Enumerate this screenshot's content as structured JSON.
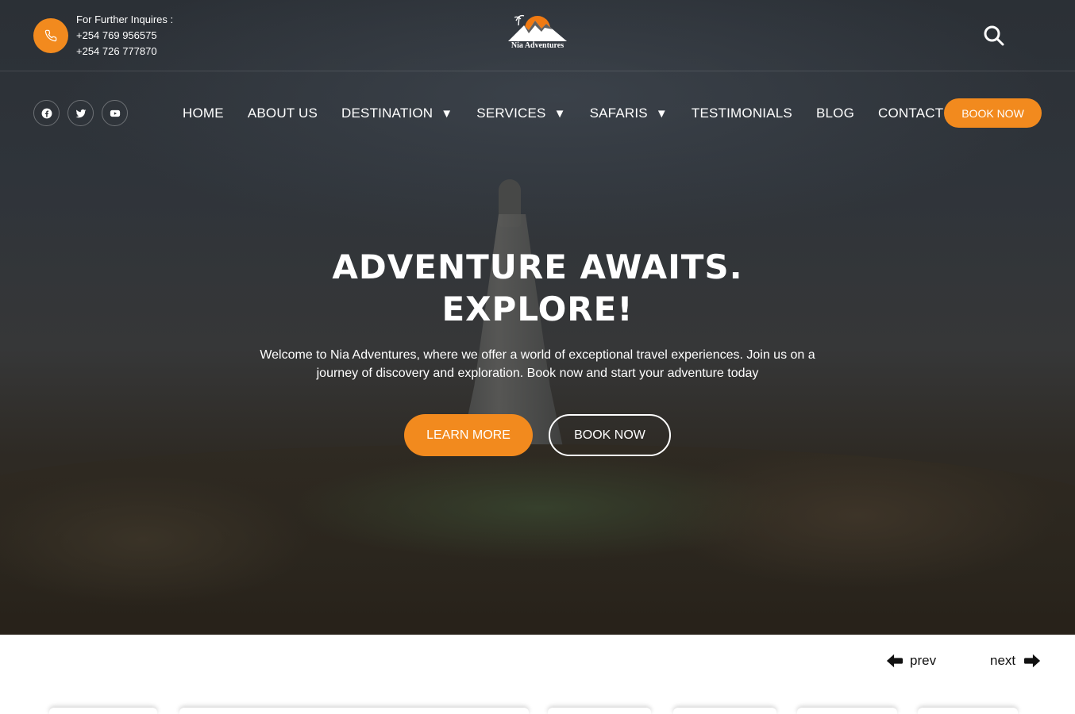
{
  "topbar": {
    "contact_label": "For Further Inquires :",
    "phone_1": "+254 769 956575",
    "phone_2": "+254 726 777870",
    "logo_text": "Nia Adventures"
  },
  "nav": {
    "items": [
      {
        "label": "HOME",
        "has_dropdown": false
      },
      {
        "label": "ABOUT US",
        "has_dropdown": false
      },
      {
        "label": "DESTINATION",
        "has_dropdown": true
      },
      {
        "label": "SERVICES",
        "has_dropdown": true
      },
      {
        "label": "SAFARIS",
        "has_dropdown": true
      },
      {
        "label": "TESTIMONIALS",
        "has_dropdown": false
      },
      {
        "label": "BLOG",
        "has_dropdown": false
      },
      {
        "label": "CONTACT US",
        "has_dropdown": false
      }
    ],
    "dropdown_caret": "▼",
    "book_now": "BOOK NOW",
    "social_icons": [
      "facebook-icon",
      "twitter-icon",
      "youtube-icon"
    ]
  },
  "hero": {
    "title_line1": "ADVENTURE AWAITS.",
    "title_line2": "EXPLORE!",
    "subtitle": "Welcome to Nia Adventures, where we offer a world of exceptional travel experiences. Join us on a journey of discovery and exploration. Book now and start your adventure today",
    "learn_more": "LEARN MORE",
    "book_now": "BOOK NOW"
  },
  "slider": {
    "prev": "prev",
    "next": "next"
  },
  "colors": {
    "accent": "#f28a1e",
    "text_on_dark": "#ffffff"
  }
}
